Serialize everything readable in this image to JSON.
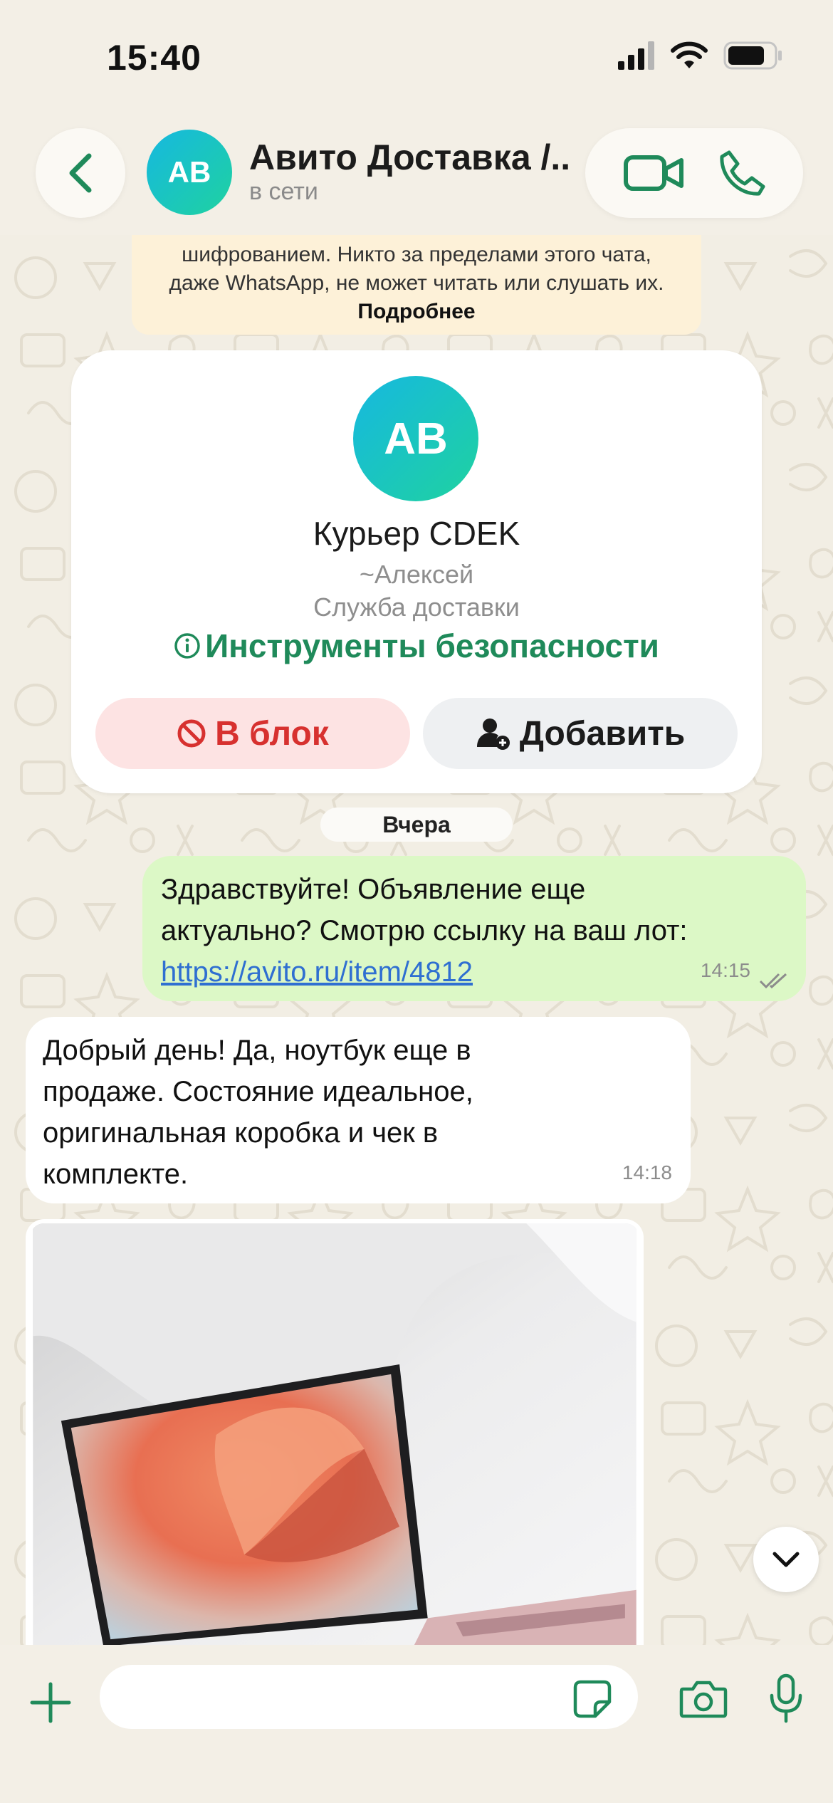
{
  "status_bar": {
    "time": "15:40"
  },
  "header": {
    "avatar_initials": "AB",
    "contact_name": "Авито Доставка /...",
    "contact_status": "в сети"
  },
  "encryption_notice": {
    "line1": "шифрованием. Никто за пределами этого чата,",
    "line2": "даже WhatsApp, не может читать или слушать их.",
    "more_label": "Подробнее"
  },
  "contact_card": {
    "avatar_initials": "AB",
    "title": "Курьер CDEK",
    "push_name": "~Алексей",
    "description": "Служба доставки",
    "safety_tools_label": "Инструменты безопасности",
    "block_label": "В блок",
    "add_label": "Добавить"
  },
  "date_separator": "Вчера",
  "messages": [
    {
      "direction": "outgoing",
      "line1": "Здравствуйте! Объявление еще",
      "line2": "актуально? Смотрю ссылку на ваш лот:",
      "link": "https://avito.ru/item/4812",
      "time": "14:15",
      "status": "read"
    },
    {
      "direction": "incoming",
      "line1": "Добрый день! Да, ноутбук еще в",
      "line2": "продаже. Состояние идеальное,",
      "line3": "оригинальная коробка и чек в",
      "line4": "комплекте.",
      "time": "14:18"
    },
    {
      "direction": "incoming",
      "type": "image",
      "subject": "laptop-photo"
    }
  ],
  "composer": {
    "placeholder": ""
  },
  "colors": {
    "accent_green": "#1f8a5a",
    "outgoing_bubble": "#dcf8c6",
    "block_red": "#d7312f",
    "link_blue": "#2f6fd1"
  },
  "icons": [
    "back-icon",
    "video-call-icon",
    "phone-icon",
    "info-icon",
    "block-icon",
    "add-contact-icon",
    "read-ticks-icon",
    "chevron-down-icon",
    "plus-icon",
    "sticker-icon",
    "camera-icon",
    "mic-icon"
  ]
}
